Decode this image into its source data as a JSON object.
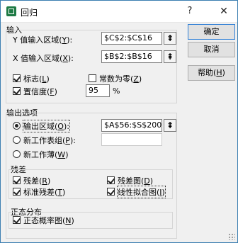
{
  "window": {
    "title": "回归",
    "help_glyph": "?",
    "close_glyph": "✕"
  },
  "input": {
    "group_label": "输入",
    "y_range_label": "Y 值输入区域(",
    "y_range_key": "Y",
    "y_range_suffix": "):",
    "y_range_value": "$C$2:$C$16",
    "x_range_label": "X 值输入区域(",
    "x_range_key": "X",
    "x_range_suffix": "):",
    "x_range_value": "$B$2:$B$16",
    "labels_text": "标志(",
    "labels_key": "L",
    "labels_suffix": ")",
    "labels_checked": true,
    "constant_zero_text": "常数为零(",
    "constant_zero_key": "Z",
    "constant_zero_suffix": ")",
    "constant_zero_checked": false,
    "confidence_text": "置信度(",
    "confidence_key": "F",
    "confidence_suffix": ")",
    "confidence_checked": true,
    "confidence_value": "95",
    "percent_sign": "%",
    "ref_glyph": "⇞"
  },
  "buttons": {
    "ok": "确定",
    "cancel": "取消",
    "help": "帮助(",
    "help_key": "H",
    "help_suffix": ")"
  },
  "output": {
    "group_label": "输出选项",
    "output_range_text": "输出区域(",
    "output_range_key": "O",
    "output_range_suffix": "):",
    "output_range_value": "$A$56:$S$200",
    "output_range_selected": true,
    "new_sheet_text": "新工作表组(",
    "new_sheet_key": "P",
    "new_sheet_suffix": "):",
    "new_sheet_value": "",
    "new_workbook_text": "新工作薄(",
    "new_workbook_key": "W",
    "new_workbook_suffix": ")"
  },
  "residuals": {
    "group_label": "残差",
    "residuals_text": "残差(",
    "residuals_key": "R",
    "residuals_suffix": ")",
    "residuals_checked": true,
    "residual_plots_text": "残差图(",
    "residual_plots_key": "D",
    "residual_plots_suffix": ")",
    "residual_plots_checked": true,
    "std_residuals_text": "标准残差(",
    "std_residuals_key": "T",
    "std_residuals_suffix": ")",
    "std_residuals_checked": true,
    "line_fit_text": "线性拟合图(",
    "line_fit_key": "I",
    "line_fit_suffix": ")",
    "line_fit_checked": true
  },
  "normal": {
    "group_label": "正态分布",
    "normal_plot_text": "正态概率图(",
    "normal_plot_key": "N",
    "normal_plot_suffix": ")",
    "normal_plot_checked": true
  }
}
